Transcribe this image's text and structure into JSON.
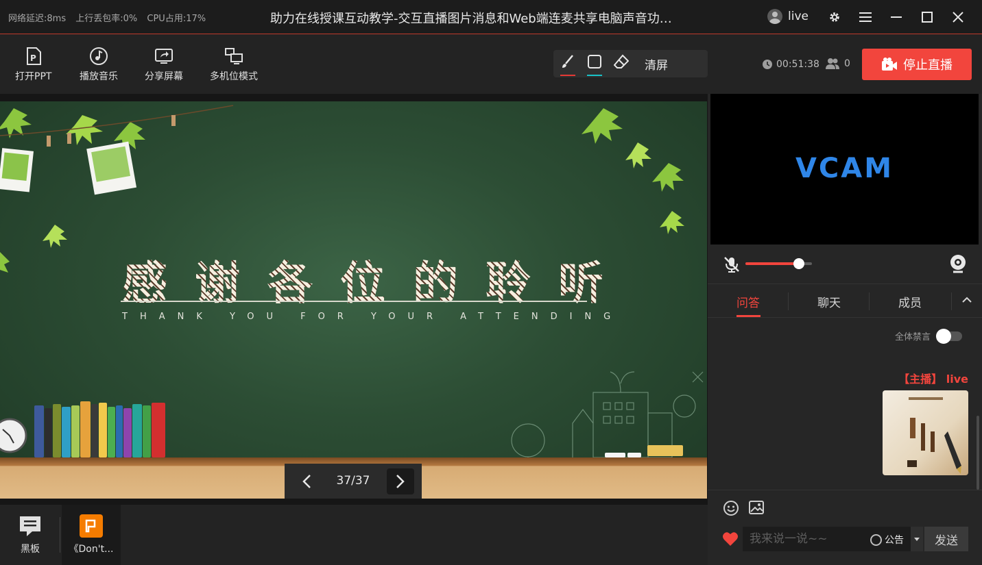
{
  "status": {
    "latency": "网络延迟:8ms",
    "packet_loss": "上行丢包率:0%",
    "cpu": "CPU占用:17%"
  },
  "window": {
    "title": "助力在线授课互动教学-交互直播图片消息和Web端连麦共享电脑声音功…",
    "user": "live"
  },
  "toolbar": {
    "tools": [
      {
        "label": "打开PPT",
        "icon": "ppt-file-icon"
      },
      {
        "label": "播放音乐",
        "icon": "music-note-icon"
      },
      {
        "label": "分享屏幕",
        "icon": "share-screen-icon"
      },
      {
        "label": "多机位模式",
        "icon": "multi-camera-icon"
      }
    ],
    "draw": {
      "pen_color": "#e53935",
      "shape_color": "#19c2c8",
      "clear_label": "清屏"
    },
    "timer": "00:51:38",
    "viewers": "0",
    "stop_label": "停止直播"
  },
  "slide": {
    "title": "感谢各位的聆听",
    "subtitle": "THANK YOU FOR YOUR ATTENDING",
    "page": "37/37"
  },
  "dock": {
    "blackboard_label": "黑板",
    "doc_label": "《Don't..."
  },
  "video": {
    "overlay": "VCAM",
    "volume": 0.8
  },
  "chat": {
    "tabs": [
      "问答",
      "聊天",
      "成员"
    ],
    "active_tab": 0,
    "mute_all_label": "全体禁言",
    "author": "【主播】 live",
    "input_placeholder": "我来说一说~~",
    "notice_label": "公告",
    "send_label": "发送"
  },
  "colors": {
    "accent": "#f2453d",
    "vcam": "#2f86e8"
  }
}
